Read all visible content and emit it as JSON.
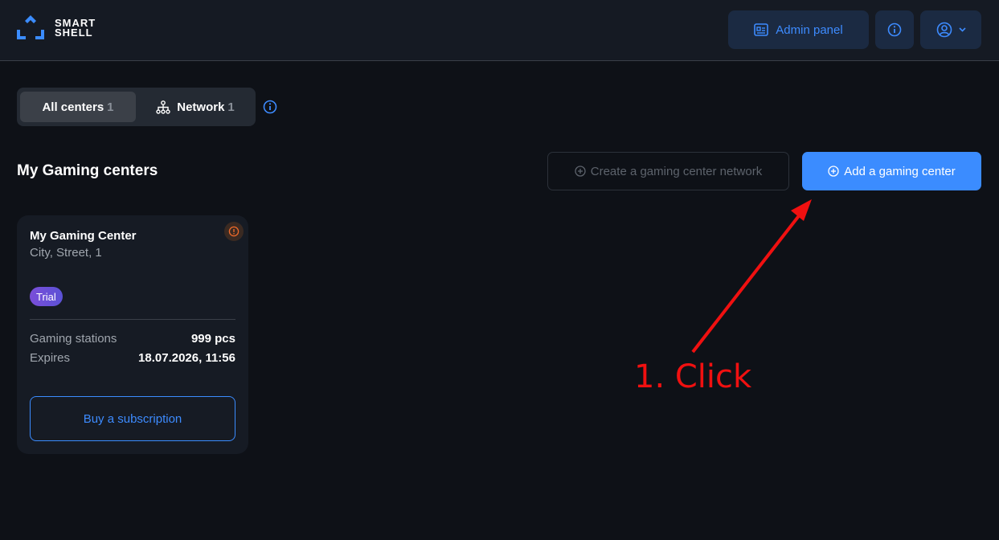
{
  "brand": {
    "line1": "SMART",
    "line2": "SHELL"
  },
  "header": {
    "admin_label": "Admin panel"
  },
  "tabs": [
    {
      "label": "All centers",
      "count": "1"
    },
    {
      "label": "Network",
      "count": "1"
    }
  ],
  "section": {
    "title": "My Gaming centers",
    "create_network_label": "Create a gaming center network",
    "add_center_label": "Add a gaming center"
  },
  "card": {
    "name": "My Gaming Center",
    "address": "City, Street, 1",
    "badge": "Trial",
    "rows": [
      {
        "label": "Gaming stations",
        "value": "999 pcs"
      },
      {
        "label": "Expires",
        "value": "18.07.2026, 11:56"
      }
    ],
    "buy_label": "Buy a subscription"
  },
  "annotation": {
    "text": "1. Click"
  },
  "colors": {
    "accent": "#3b8cff",
    "background": "#0e1117",
    "annotation": "#f01010",
    "warning": "#f06a2a"
  }
}
